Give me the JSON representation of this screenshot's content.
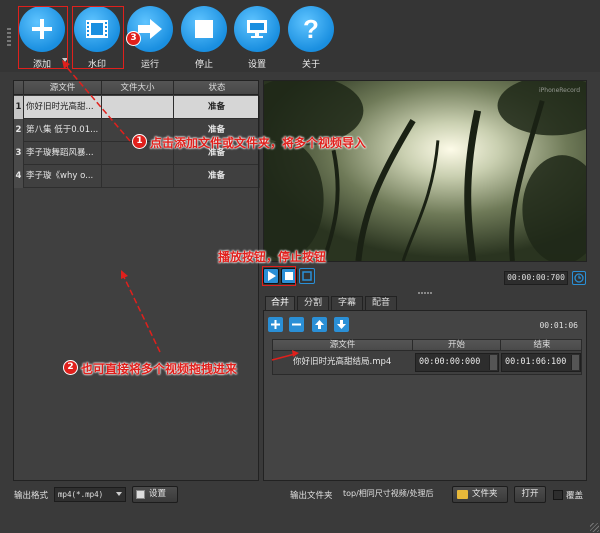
{
  "toolbar": {
    "add_label": "添加",
    "watermark_label": "水印",
    "run_label": "运行",
    "stop_label": "停止",
    "settings_label": "设置",
    "about_label": "关于",
    "about_glyph": "?"
  },
  "file_table": {
    "headers": [
      "源文件",
      "文件大小",
      "状态"
    ],
    "rows": [
      {
        "num": "1",
        "name": "你好旧时光高甜...",
        "size": "",
        "status": "准备"
      },
      {
        "num": "2",
        "name": "第八集 低于0.01...",
        "size": "",
        "status": "准备"
      },
      {
        "num": "3",
        "name": "李子璇舞蹈风暴...",
        "size": "",
        "status": "准备"
      },
      {
        "num": "4",
        "name": "李子璇《why o...",
        "size": "",
        "status": "准备"
      }
    ]
  },
  "preview": {
    "watermark": "iPhoneRecord"
  },
  "player": {
    "time": "00:00:00:700"
  },
  "tabs": [
    "合并",
    "分割",
    "字幕",
    "配音"
  ],
  "merge_panel": {
    "total_duration": "00:01:06",
    "headers": [
      "源文件",
      "开始",
      "结束"
    ],
    "segment": {
      "name": "你好旧时光高甜结局.mp4",
      "start": "00:00:00:000",
      "end": "00:01:06:100"
    }
  },
  "bottom": {
    "format_label": "输出格式",
    "format_value": "mp4(*.mp4)",
    "format_settings_label": "设置",
    "folder_label": "输出文件夹",
    "folder_value": "top/相同尺寸视频/处理后",
    "folder_button_label": "文件夹",
    "open_label": "打开",
    "overwrite_label": "覆盖"
  },
  "annotations": {
    "badge1": "1",
    "text1": "点击添加文件或文件夹，将多个视频导入",
    "badge2": "2",
    "text2": "也可直接将多个视频拖拽进来",
    "badge3": "3",
    "text4": "播放按钮，停止按钮"
  },
  "colors": {
    "accent_blue": "#2a8fd6",
    "annotation_red": "#e0201c",
    "background": "#3a3a3a"
  }
}
